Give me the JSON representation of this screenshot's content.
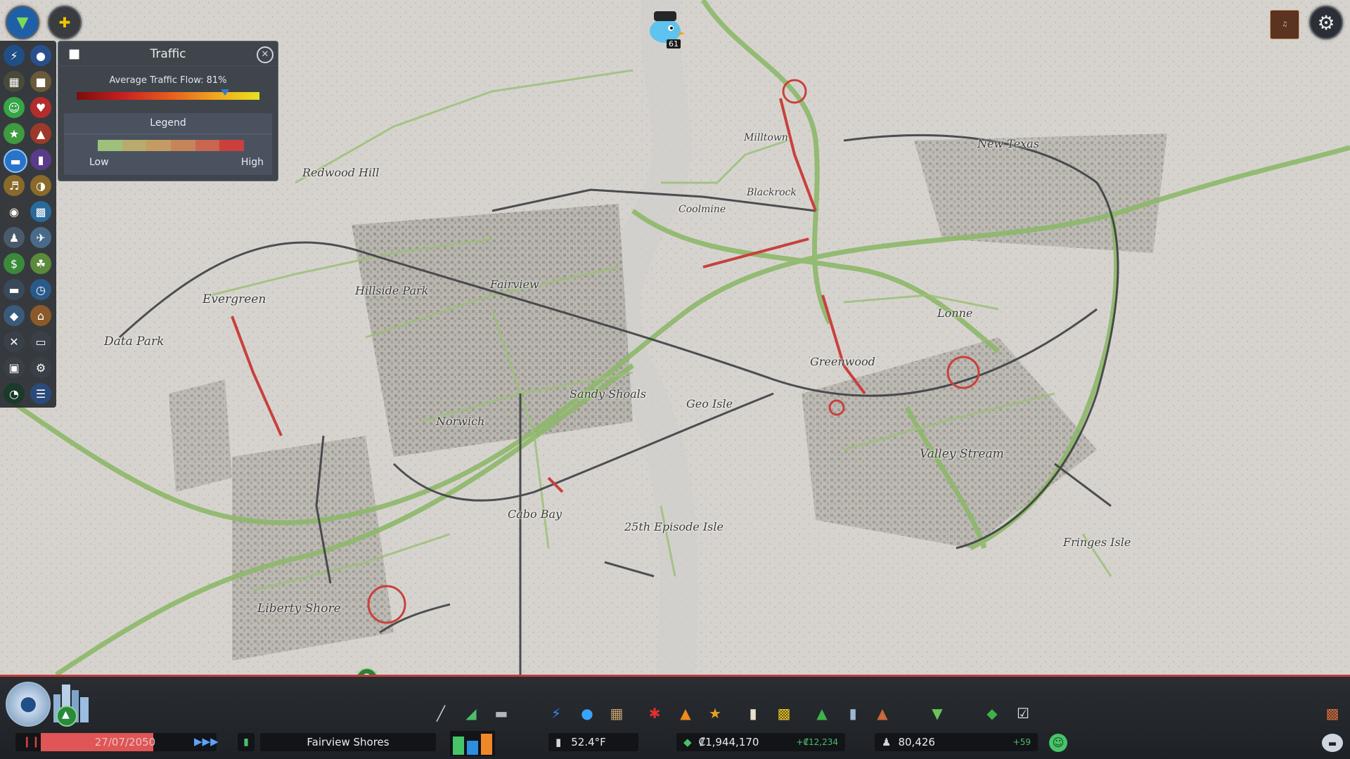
{
  "traffic_panel": {
    "title": "Traffic",
    "avg_flow_label": "Average Traffic Flow: 81%",
    "avg_flow_value": 0.81,
    "legend_title": "Legend",
    "legend_low": "Low",
    "legend_high": "High",
    "legend_colors": [
      "#9fc07a",
      "#b8ab6c",
      "#c49b62",
      "#c6845a",
      "#c86650",
      "#c9403c"
    ]
  },
  "chirper": {
    "notification_count": "61"
  },
  "districts": [
    "Redwood Hill",
    "Evergreen",
    "Data Park",
    "Hillside Park",
    "Fairview",
    "Milltown",
    "Blackrock",
    "Coolmine",
    "New Texas",
    "Lonne",
    "Greenwood",
    "Sandy Shoals",
    "Geo Isle",
    "Norwich",
    "Valley Stream",
    "Cabo Bay",
    "25th Episode Isle",
    "Fringes Isle",
    "Liberty Shore"
  ],
  "status_bar": {
    "date": "27/07/2050",
    "city_name": "Fairview Shores",
    "temperature": "52.4°F",
    "money": "₡1,944,170",
    "income": "+₡12,234",
    "population": "80,426",
    "population_change": "+59"
  },
  "help_icon_glyph": "?",
  "icons": [
    "unlock-icon",
    "chirper-icon",
    "classics-radio-icon",
    "settings-gear-icon",
    "close-icon",
    "bulldozer-icon",
    "pause-icon",
    "speed-icon"
  ],
  "colors": {
    "accent_red": "#c23c3c",
    "road_green": "#8db86a",
    "rail_dark": "#3d3f43"
  }
}
